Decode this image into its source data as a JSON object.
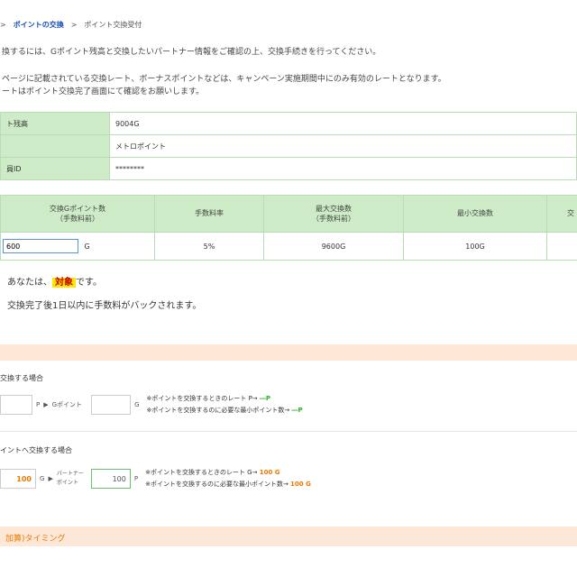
{
  "breadcrumb": {
    "parent_link": "ポイントの交換",
    "separator": ">",
    "current": "ポイント交換受付"
  },
  "notice": {
    "line1": "換するには、Gポイント残高と交換したいパートナー情報をご確認の上、交換手続きを行ってください。",
    "line2": "ページに記載されている交換レート、ボーナスポイントなどは、キャンペーン実施期間中にのみ有効のレートとなります。",
    "line3": "ートはポイント交換完了画面にて確認をお願いします。"
  },
  "info_table": [
    {
      "label": "ト残高",
      "value": "9004G"
    },
    {
      "label": "",
      "value": "メトロポイント"
    },
    {
      "label": "員ID",
      "value": "********"
    }
  ],
  "exchange_table": {
    "headers": [
      "交換Gポイント数\n（手数料前）",
      "手数料率",
      "最大交換数\n（手数料前）",
      "最小交換数",
      "交"
    ],
    "amount_value": "600",
    "amount_unit": "G",
    "fee_rate": "5%",
    "max": "9600G",
    "min": "100G"
  },
  "status": {
    "prefix": "あなたは、",
    "highlight": "対象",
    "suffix": "です。"
  },
  "refund_note": "交換完了後1日以内に手数料がバックされます。",
  "calc1": {
    "section_label": "交換する場合",
    "unit1": "P",
    "arrow_label": "Gポイント",
    "unit2": "G",
    "note1_prefix": "※ポイントを交換するときのレート P→",
    "note1_value": "―P",
    "note2_prefix": "※ポイントを交換するのに必要な最小ポイント数→",
    "note2_value": "―P"
  },
  "calc2": {
    "section_label": "イントへ交換する場合",
    "box1_value": "100",
    "unit1": "G",
    "partner_label_line1": "パートナー",
    "partner_label_line2": "ポイント",
    "box2_value": "100",
    "unit2": "P",
    "note1_prefix": "※ポイントを交換するときのレート G→",
    "note1_value": "100 G",
    "note2_prefix": "※ポイントを交換するのに必要な最小ポイント数→",
    "note2_value": "100 G"
  },
  "timing_link": "加算)タイミング",
  "colors": {
    "green_header": "#cdebc6",
    "green_border": "#b8dcb8",
    "accent_orange": "#f07800",
    "link_blue": "#1a4fb8",
    "highlight_yellow": "#ffe600"
  }
}
